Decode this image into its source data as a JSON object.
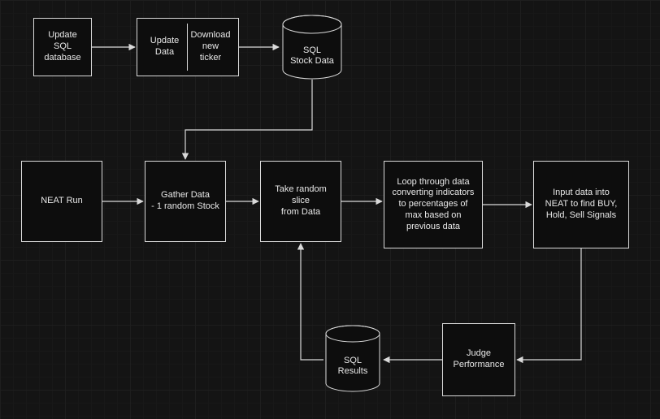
{
  "nodes": {
    "update_sql_db": "Update\nSQL\ndatabase",
    "split_left": "Update\nData",
    "split_right": "Download\nnew ticker",
    "db_stock": "SQL\nStock Data",
    "neat_run": "NEAT Run",
    "gather": "Gather Data\n- 1 random Stock",
    "slice": "Take random slice\nfrom Data",
    "loop": "Loop through data\nconverting indicators\nto percentages of\nmax based on\nprevious data",
    "input_neat": "Input data into\nNEAT to find BUY,\nHold, Sell Signals",
    "judge": "Judge\nPerformance",
    "db_results": "SQL\nResults"
  },
  "colors": {
    "stroke": "#d9d9d9",
    "bg": "#141414",
    "node_bg": "#0d0d0d"
  },
  "chart_data": {
    "type": "diagram",
    "title": "",
    "nodes": [
      {
        "id": "update_sql_db",
        "label": "Update SQL database",
        "shape": "rect"
      },
      {
        "id": "update_download",
        "label": "Update Data / Download new ticker",
        "shape": "rect-split"
      },
      {
        "id": "sql_stock_data",
        "label": "SQL Stock Data",
        "shape": "cylinder"
      },
      {
        "id": "neat_run",
        "label": "NEAT Run",
        "shape": "rect"
      },
      {
        "id": "gather_data",
        "label": "Gather Data - 1 random Stock",
        "shape": "rect"
      },
      {
        "id": "random_slice",
        "label": "Take random slice from Data",
        "shape": "rect"
      },
      {
        "id": "loop_convert",
        "label": "Loop through data converting indicators to percentages of max based on previous data",
        "shape": "rect"
      },
      {
        "id": "input_neat",
        "label": "Input data into NEAT to find BUY, Hold, Sell Signals",
        "shape": "rect"
      },
      {
        "id": "judge_performance",
        "label": "Judge Performance",
        "shape": "rect"
      },
      {
        "id": "sql_results",
        "label": "SQL Results",
        "shape": "cylinder"
      }
    ],
    "edges": [
      {
        "from": "update_sql_db",
        "to": "update_download"
      },
      {
        "from": "update_download",
        "to": "sql_stock_data"
      },
      {
        "from": "sql_stock_data",
        "to": "gather_data"
      },
      {
        "from": "neat_run",
        "to": "gather_data"
      },
      {
        "from": "gather_data",
        "to": "random_slice"
      },
      {
        "from": "random_slice",
        "to": "loop_convert"
      },
      {
        "from": "loop_convert",
        "to": "input_neat"
      },
      {
        "from": "input_neat",
        "to": "judge_performance"
      },
      {
        "from": "judge_performance",
        "to": "sql_results"
      },
      {
        "from": "sql_results",
        "to": "random_slice"
      }
    ]
  }
}
